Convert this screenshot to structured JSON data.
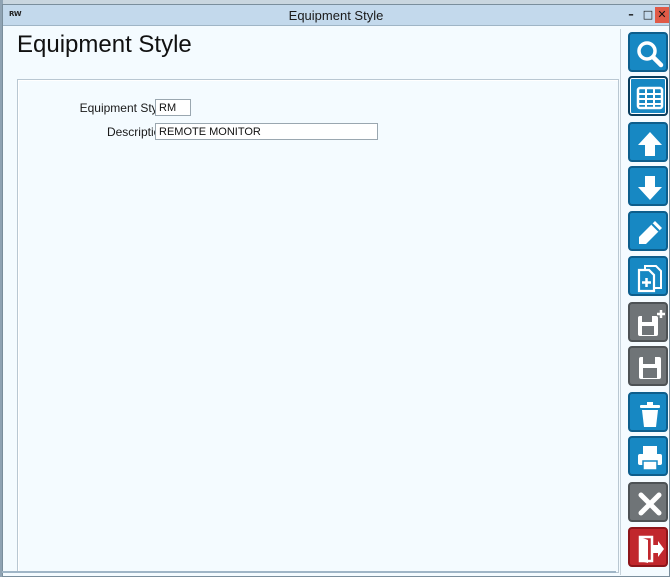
{
  "window": {
    "title": "Equipment Style",
    "app_icon_text": "RW",
    "controls": {
      "minimize": "–",
      "maximize": "□",
      "close": "✕"
    }
  },
  "page": {
    "heading": "Equipment Style"
  },
  "form": {
    "equipment_style": {
      "label": "Equipment Style",
      "value": "RM"
    },
    "description": {
      "label": "Description",
      "value": "REMOTE MONITOR"
    }
  },
  "toolbar": {
    "buttons": [
      {
        "name": "search",
        "icon": "search-icon",
        "color": "#1788c3",
        "enabled": true
      },
      {
        "name": "grid-view",
        "icon": "table-icon",
        "color": "#1788c3",
        "enabled": true,
        "active": true
      },
      {
        "name": "previous-record",
        "icon": "arrow-up-icon",
        "color": "#1788c3",
        "enabled": true
      },
      {
        "name": "next-record",
        "icon": "arrow-down-icon",
        "color": "#1788c3",
        "enabled": true
      },
      {
        "name": "edit",
        "icon": "pencil-icon",
        "color": "#1788c3",
        "enabled": true
      },
      {
        "name": "copy-new",
        "icon": "copy-document-icon",
        "color": "#1788c3",
        "enabled": true
      },
      {
        "name": "save-new",
        "icon": "save-plus-icon",
        "color": "#6f7477",
        "enabled": false
      },
      {
        "name": "save",
        "icon": "save-icon",
        "color": "#6f7477",
        "enabled": false
      },
      {
        "name": "delete",
        "icon": "trash-icon",
        "color": "#1788c3",
        "enabled": true
      },
      {
        "name": "print",
        "icon": "printer-icon",
        "color": "#1788c3",
        "enabled": true
      },
      {
        "name": "cancel",
        "icon": "x-icon",
        "color": "#6f7477",
        "enabled": false
      },
      {
        "name": "exit",
        "icon": "exit-door-icon",
        "color": "#c1272d",
        "enabled": true
      }
    ]
  }
}
